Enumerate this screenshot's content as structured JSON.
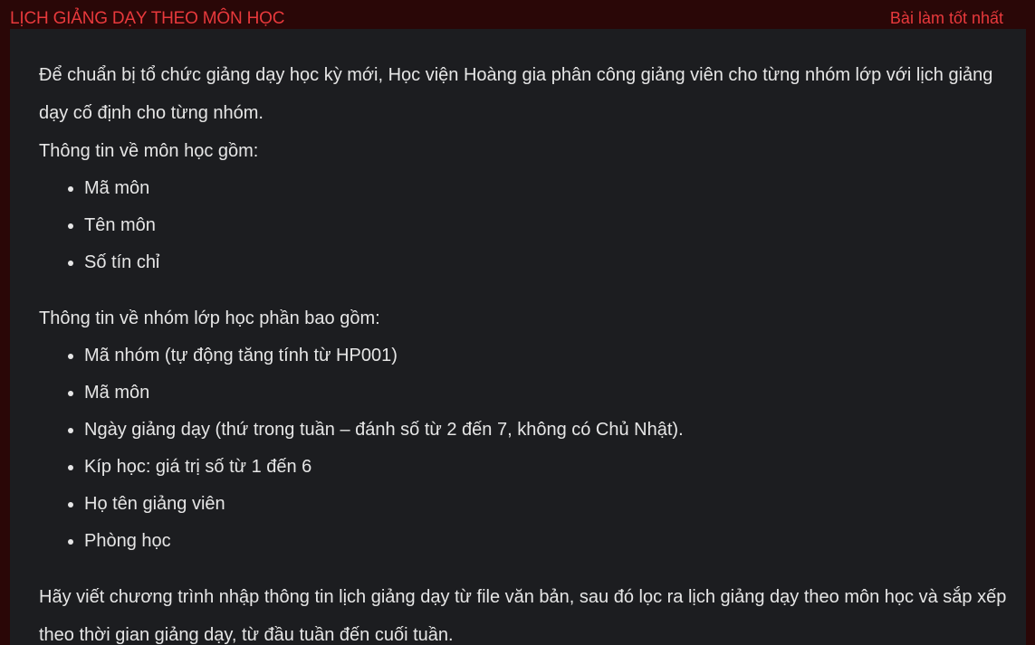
{
  "header": {
    "title": "LỊCH GIẢNG DẠY THEO MÔN HỌC",
    "best_link": "Bài làm tốt nhất"
  },
  "problem": {
    "intro": "Để chuẩn bị tổ chức giảng dạy học kỳ mới, Học viện Hoàng gia phân công giảng viên cho từng nhóm lớp với lịch giảng dạy cố định cho từng nhóm.",
    "course_heading": "Thông tin về môn học gồm:",
    "course_items": [
      "Mã môn",
      "Tên môn",
      "Số tín chỉ"
    ],
    "group_heading": "Thông tin về nhóm lớp học phần bao gồm:",
    "group_items": [
      "Mã nhóm (tự động tăng tính từ HP001)",
      "Mã môn",
      "Ngày giảng dạy (thứ trong tuần – đánh số từ 2 đến 7, không có Chủ Nhật).",
      "Kíp học: giá trị số từ 1 đến 6",
      "Họ tên giảng viên",
      "Phòng học"
    ],
    "task": "Hãy viết chương trình nhập thông tin lịch giảng dạy từ file văn bản, sau đó lọc ra lịch giảng dạy theo môn học và sắp xếp theo thời gian giảng dạy, từ đầu tuần đến cuối tuần."
  }
}
